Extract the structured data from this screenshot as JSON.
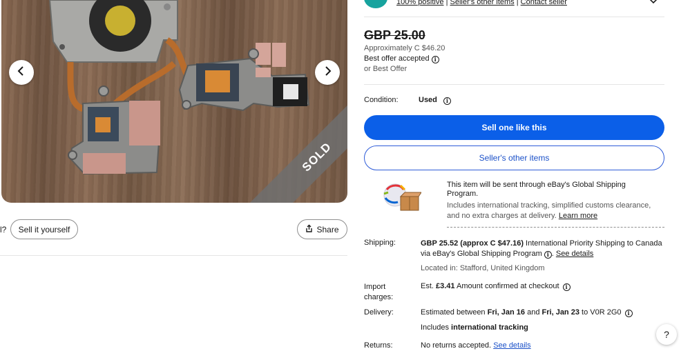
{
  "seller": {
    "feedback": "100% positive",
    "other_items": "Seller's other items",
    "contact": "Contact seller"
  },
  "price": {
    "original": "GBP 25.00",
    "approx": "Approximately C $46.20",
    "best_offer": "Best offer accepted",
    "or_best": "or Best Offer"
  },
  "condition": {
    "label": "Condition:",
    "value": "Used"
  },
  "buttons": {
    "sell_one": "Sell one like this",
    "sellers_other": "Seller's other items",
    "sell_it_yourself": "Sell it yourself",
    "share": "Share",
    "left_fragment": "l?"
  },
  "gallery": {
    "sold_label": "SOLD"
  },
  "gsp": {
    "title": "This item will be sent through eBay's Global Shipping Program.",
    "desc": "Includes international tracking, simplified customs clearance, and no extra charges at delivery.",
    "learn_more": "Learn more"
  },
  "shipping": {
    "label": "Shipping:",
    "amount": "GBP 25.52 (approx C $47.16)",
    "line1_rest": "International Priority Shipping to Canada",
    "line2": "via eBay's Global Shipping Program",
    "see_details": "See details",
    "located": "Located in: Stafford, United Kingdom"
  },
  "import": {
    "label_1": "Import",
    "label_2": "charges:",
    "prefix": "Est.",
    "amount": "£3.41",
    "rest": "Amount confirmed at checkout"
  },
  "delivery": {
    "label": "Delivery:",
    "prefix": "Estimated between",
    "date_from": "Fri, Jan 16",
    "and": "and",
    "date_to": "Fri, Jan 23",
    "to": "to V0R 2G0",
    "includes": "Includes",
    "tracking": "international tracking"
  },
  "returns": {
    "label": "Returns:",
    "text": "No returns accepted.",
    "see_details": "See details"
  },
  "help": "?",
  "colors": {
    "primary_blue": "#0b5fe8",
    "link_blue": "#1a50c8",
    "sold_grey": "#6e6e6e"
  }
}
